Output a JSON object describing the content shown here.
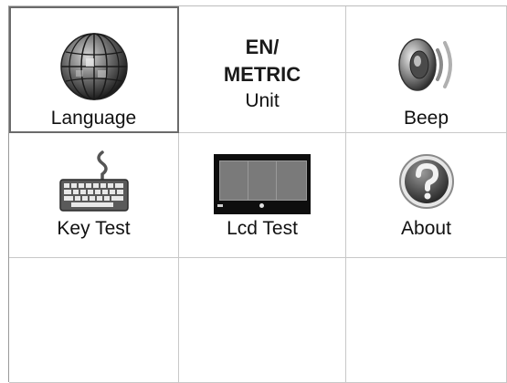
{
  "menu": {
    "items": [
      {
        "label": "Language",
        "icon": "globe-icon",
        "selected": true
      },
      {
        "label": "Unit",
        "icon": "unit-text",
        "lines": [
          "EN/",
          "METRIC"
        ]
      },
      {
        "label": "Beep",
        "icon": "speaker-icon"
      },
      {
        "label": "Key Test",
        "icon": "keyboard-icon"
      },
      {
        "label": "Lcd Test",
        "icon": "lcd-screen-icon"
      },
      {
        "label": "About",
        "icon": "question-icon"
      }
    ]
  }
}
